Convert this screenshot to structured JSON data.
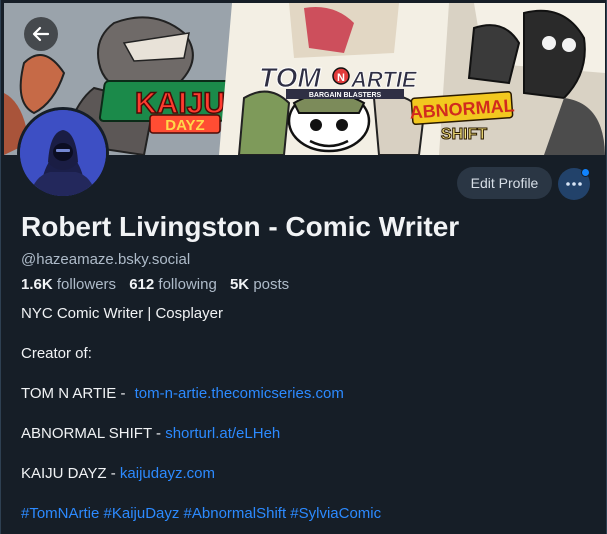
{
  "profile": {
    "display_name": "Robert Livingston - Comic Writer",
    "handle": "@hazeamaze.bsky.social",
    "stats": {
      "followers_count": "1.6K",
      "followers_label": "followers",
      "following_count": "612",
      "following_label": "following",
      "posts_count": "5K",
      "posts_label": "posts"
    },
    "bio": {
      "tagline": "NYC Comic Writer | Cosplayer",
      "creator_of": "Creator of:",
      "works": [
        {
          "title": "TOM N ARTIE - ",
          "link": "tom-n-artie.thecomicseries.com"
        },
        {
          "title": "ABNORMAL SHIFT - ",
          "link": "shorturl.at/eLHeh"
        },
        {
          "title": "KAIJU DAYZ - ",
          "link": "kaijudayz.com"
        }
      ],
      "hashtags": "#TomNArtie #KaijuDayz #AbnormalShift #SylviaComic"
    }
  },
  "actions": {
    "edit_profile_label": "Edit Profile",
    "more_icon": "ellipsis-icon",
    "back_icon": "arrow-left-icon"
  },
  "banner": {
    "logos": {
      "kaiju": "KAIJU",
      "kaiju_sub": "DAYZ",
      "tom": "TOM",
      "n": "N",
      "artie": "ARTIE",
      "tom_sub": "BARGAIN BLASTERS",
      "abnormal": "ABNORMAL",
      "shift": "SHIFT"
    }
  },
  "colors": {
    "background": "#161e27",
    "link": "#2c8aff",
    "muted_text": "#aebbc9",
    "button_bg": "#2a3644",
    "badge": "#1083fe"
  }
}
